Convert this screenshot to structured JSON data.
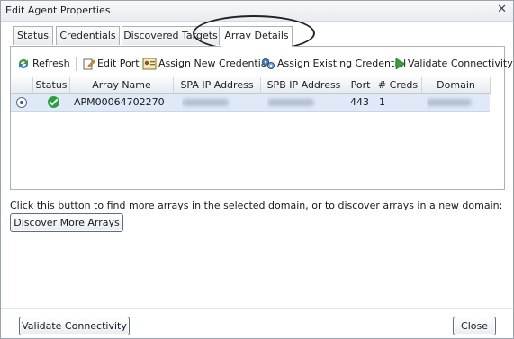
{
  "window": {
    "title": "Edit Agent Properties",
    "close_glyph": "✕"
  },
  "tabs": [
    {
      "label": "Status"
    },
    {
      "label": "Credentials"
    },
    {
      "label": "Discovered Targets"
    },
    {
      "label": "Array Details",
      "active": true
    }
  ],
  "toolbar": {
    "refresh": "Refresh",
    "edit_port": "Edit Port",
    "assign_new": "Assign New Credential",
    "assign_existing": "Assign Existing Credential",
    "validate": "Validate Connectivity"
  },
  "table": {
    "headers": [
      "Status",
      "Array Name",
      "SPA IP Address",
      "SPB IP Address",
      "Port",
      "# Creds",
      "Domain"
    ],
    "rows": [
      {
        "selected": true,
        "status": "ok-icon",
        "array_name": "APM00064702270",
        "spa_ip": "",
        "spb_ip": "",
        "port": "443",
        "creds": "1",
        "domain": ""
      }
    ]
  },
  "info_text": "Click this button to find more arrays in the selected domain, or to discover arrays in a new domain:",
  "buttons": {
    "discover_more": "Discover More Arrays",
    "validate_connectivity": "Validate Connectivity",
    "close": "Close"
  },
  "colors": {
    "accent": "#2a5fa0",
    "row_selected": "#dfe9f7",
    "ok": "#27a23a"
  }
}
